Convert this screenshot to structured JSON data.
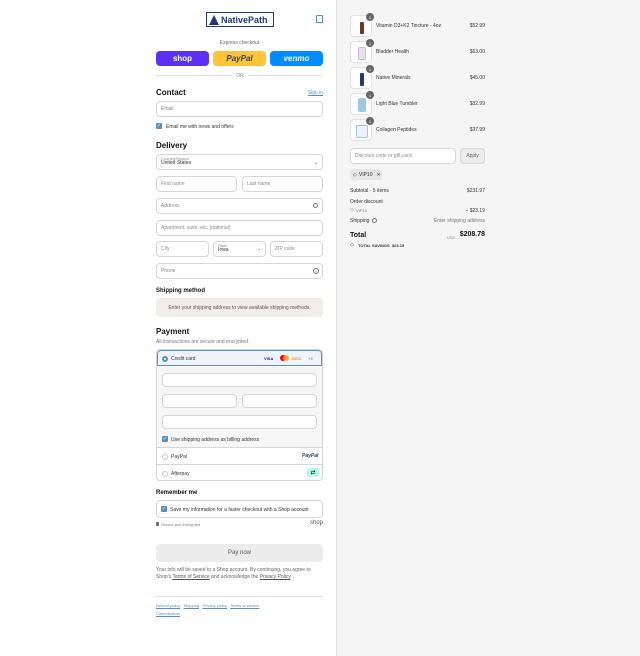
{
  "brand": {
    "name": "NativePath"
  },
  "express": {
    "title": "Express checkout",
    "shop_label": "shop",
    "paypal_label": "PayPal",
    "venmo_label": "venmo",
    "or": "OR"
  },
  "contact": {
    "title": "Contact",
    "signin": "Sign in",
    "email_placeholder": "Email",
    "news_label": "Email me with news and offers"
  },
  "delivery": {
    "title": "Delivery",
    "country_label": "Country/Region",
    "country_value": "United States",
    "first_name": "First name",
    "last_name": "Last name",
    "address": "Address",
    "apartment": "Apartment, suite, etc. (optional)",
    "city": "City",
    "state_label": "State",
    "state_value": "Iowa",
    "zip": "ZIP code",
    "phone": "Phone"
  },
  "shipping_method": {
    "title": "Shipping method",
    "message": "Enter your shipping address to view available shipping methods."
  },
  "payment": {
    "title": "Payment",
    "subtitle": "All transactions are secure and encrypted.",
    "credit_card": "Credit card",
    "card_brands": [
      "VISA",
      "MC",
      "DISC"
    ],
    "more_cards": "+3",
    "billing_label": "Use shipping address as billing address",
    "paypal": "PayPal",
    "paypal_logo": "PayPal",
    "afterpay": "Afterpay"
  },
  "remember": {
    "title": "Remember me",
    "label": "Save my information for a faster checkout with a Shop account",
    "secure": "Secure and encrypted",
    "shop_logo": "shop"
  },
  "pay_now": "Pay now",
  "legal": {
    "text1": "Your info will be saved to a Shop account. By continuing, you agree to Shop's ",
    "terms": "Terms of Service",
    "text2": " and acknowledge the ",
    "privacy": "Privacy Policy",
    "text3": "."
  },
  "footer_links": [
    "Refund policy",
    "Shipping",
    "Privacy policy",
    "Terms of service",
    "Cancellations"
  ],
  "cart": {
    "items": [
      {
        "name": "Vitamin D3+K2 Tincture - 4oz",
        "qty": "1",
        "price": "$52.99"
      },
      {
        "name": "Bladder Health",
        "qty": "1",
        "price": "$63.00"
      },
      {
        "name": "Native Minerals",
        "qty": "1",
        "price": "$45.00"
      },
      {
        "name": "Light Blue Tumbler",
        "qty": "1",
        "price": "$32.99"
      },
      {
        "name": "Collagen Peptides",
        "qty": "1",
        "price": "$37.99"
      }
    ],
    "discount_placeholder": "Discount code or gift card",
    "apply": "Apply",
    "tag": "VIP10",
    "subtotal_label": "Subtotal · 5 items",
    "subtotal_value": "$231.97",
    "order_discount_label": "Order discount",
    "discount_code": "VIP10",
    "discount_value": "− $23.19",
    "shipping_label": "Shipping",
    "shipping_value": "Enter shipping address",
    "total_label": "Total",
    "currency": "USD",
    "total_value": "$208.78",
    "savings_label": "TOTAL SAVINGS",
    "savings_value": "$23.19"
  },
  "colors": {
    "shop": "#5a31f4",
    "paypal": "#ffc439",
    "venmo": "#008cff",
    "accent": "#5b8fb9"
  }
}
